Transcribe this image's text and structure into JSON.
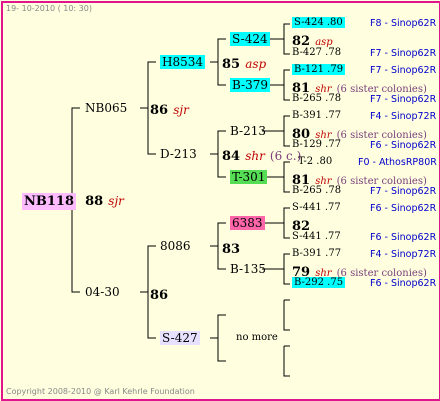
{
  "header": {
    "date": "19- 10-2010 ( 10: 30)"
  },
  "footer": {
    "copyright": "Copyright 2008-2010 @ Karl Kehrle Foundation"
  },
  "root": {
    "name": "NB118",
    "year": "88",
    "tag": "sjr"
  },
  "gen1": [
    {
      "name": "NB065",
      "year": "86",
      "tag": "sjr"
    },
    {
      "name": "04-30",
      "year": "86"
    }
  ],
  "gen2": [
    {
      "name": "H8534",
      "year": "85",
      "tag": "asp"
    },
    {
      "name": "D-213",
      "year": "84",
      "tag": "shr",
      "note": "(6 c.)"
    },
    {
      "name": "8086",
      "year": "83"
    },
    {
      "name": "S-427",
      "note": "no more"
    }
  ],
  "gen3": [
    {
      "name": "S-424"
    },
    {
      "name": "B-379"
    },
    {
      "name": "B-213"
    },
    {
      "name": "T-301"
    },
    {
      "name": "6383"
    },
    {
      "name": "B-135"
    }
  ],
  "gen4": [
    {
      "block": "S-424 .80",
      "year": "82",
      "tag": "asp",
      "right": "F8 - Sinop62R"
    },
    {
      "block": "B-427 .78",
      "right": "F7 - Sinop62R"
    },
    {
      "block": "B-121 .79",
      "right": "F7 - Sinop62R"
    },
    {
      "year": "81",
      "tag": "shr",
      "note": "(6 sister colonies)"
    },
    {
      "block": "B-265 .78",
      "right": "F7 - Sinop62R"
    },
    {
      "block": "B-391 .77",
      "right": "F4 - Sinop72R"
    },
    {
      "year": "80",
      "tag": "shr",
      "note": "(6 sister colonies)"
    },
    {
      "block": "B-129 .77",
      "right": "F6 - Sinop62R"
    },
    {
      "block": "T-2 .80",
      "right": "F0 - AthosRP80R"
    },
    {
      "year": "81",
      "tag": "shr",
      "note": "(6 sister colonies)"
    },
    {
      "block": "B-265 .78",
      "right": "F7 - Sinop62R"
    },
    {
      "block": "S-441 .77",
      "right": "F6 - Sinop62R"
    },
    {
      "year": "82"
    },
    {
      "block": "S-441 .77",
      "right": "F6 - Sinop62R"
    },
    {
      "block": "B-391 .77",
      "right": "F4 - Sinop72R"
    },
    {
      "year": "79",
      "tag": "shr",
      "note": "(6 sister colonies)"
    },
    {
      "block": "B-292 .75",
      "right": "F6 - Sinop62R"
    }
  ]
}
